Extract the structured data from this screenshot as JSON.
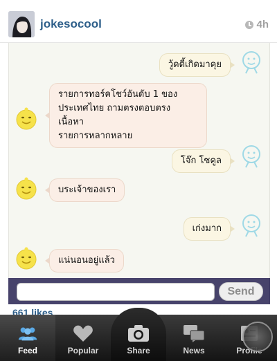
{
  "header": {
    "username": "jokesocool",
    "time_ago": "4h"
  },
  "chat": {
    "messages": [
      {
        "side": "right",
        "text": "วู้ดดี้เกิดมาคุย"
      },
      {
        "side": "left",
        "text": "รายการทอร์คโชว์อันดับ 1 ของ\nประเทศไทย ถามตรงตอบตรง เนื้อหา\nรายการหลากหลาย"
      },
      {
        "side": "right",
        "text": "โจ๊ก โซคูล"
      },
      {
        "side": "left",
        "text": "บระเจ้าของเรา"
      },
      {
        "side": "right",
        "text": "เก่งมาก"
      },
      {
        "side": "left",
        "text": "แน่นอนอยู่แล้ว"
      }
    ]
  },
  "input_bar": {
    "input_value": "",
    "send_label": "Send"
  },
  "likes": "661 likes",
  "tabbar": {
    "tabs": [
      {
        "label": "Feed",
        "icon": "people-icon"
      },
      {
        "label": "Popular",
        "icon": "heart-icon"
      },
      {
        "label": "Share",
        "icon": "camera-icon"
      },
      {
        "label": "News",
        "icon": "speech-bubbles-icon"
      },
      {
        "label": "Profile",
        "icon": "profile-card-icon"
      }
    ]
  },
  "colors": {
    "username": "#2e5f8a",
    "input_bar": "#47436b",
    "tabbar": "#1e1e1e",
    "bubble_right": "#fbf6e3",
    "bubble_left": "#fbeee6",
    "simsimi_yellow": "#f6e24a"
  }
}
